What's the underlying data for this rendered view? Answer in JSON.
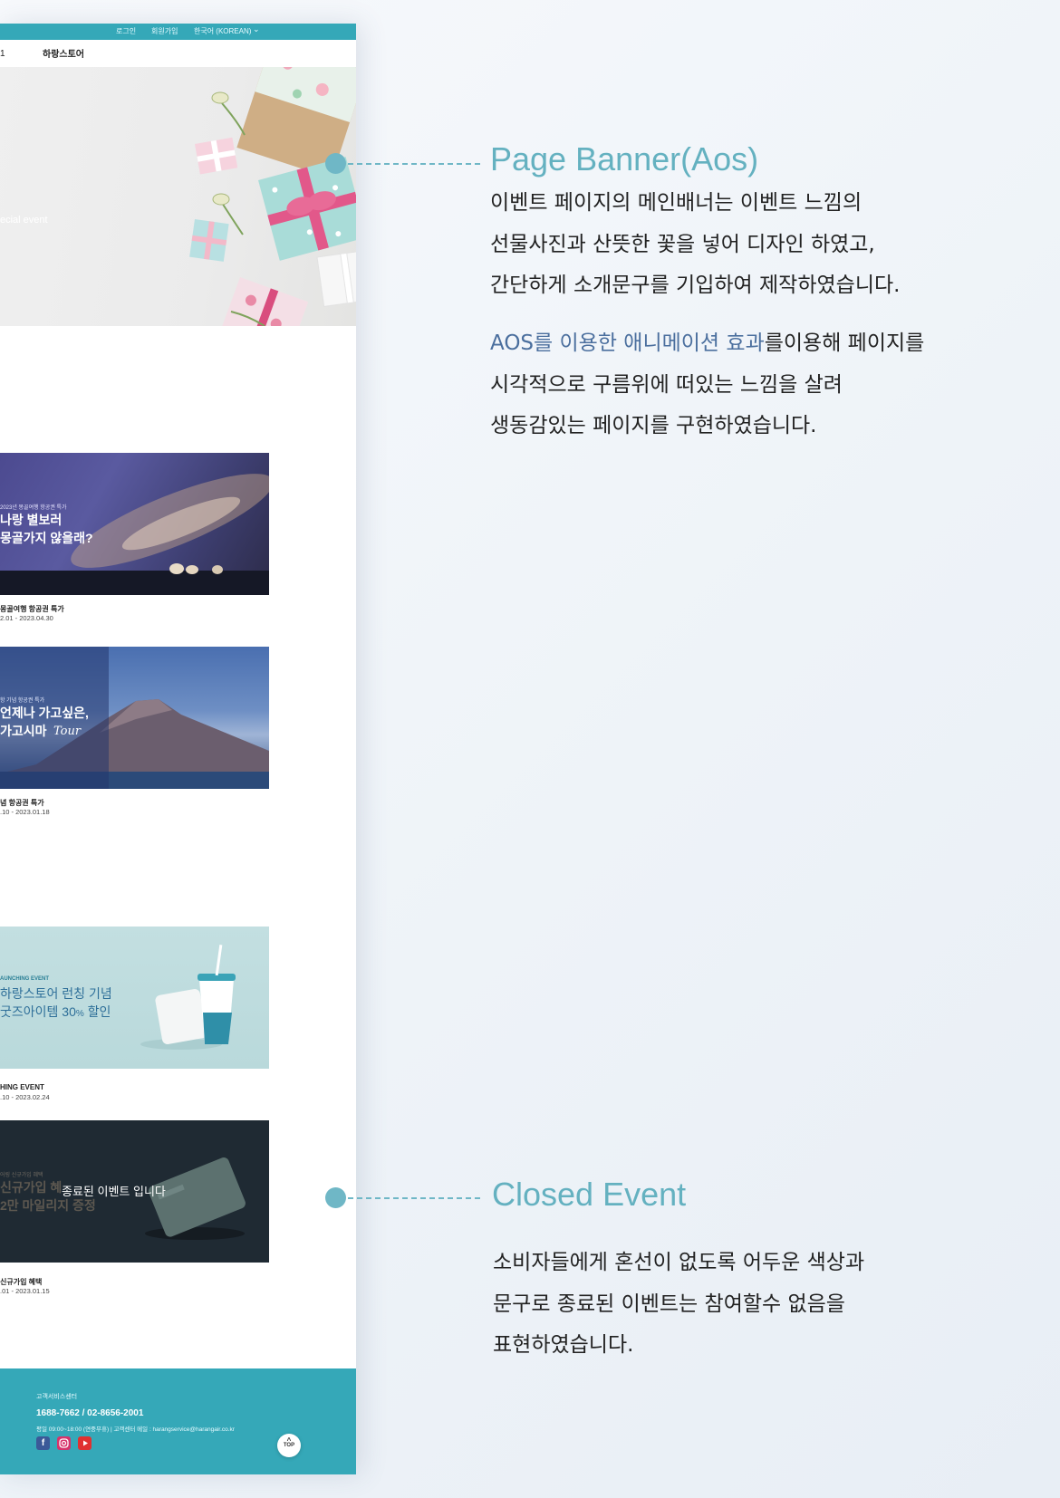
{
  "mockup": {
    "topbar": {
      "login": "로그인",
      "signup": "회원가입",
      "language": "한국어 (KOREAN)",
      "language_caret": "⌄"
    },
    "nav": {
      "left_glyph": "1",
      "brand": "하랑스토어"
    },
    "hero": {
      "caption": "ecial event"
    },
    "events": [
      {
        "banner_small": "2023년 몽골여행 항공권 특가",
        "banner_line1": "나랑 별보러",
        "banner_line2": "몽골가지 않을래?",
        "title": "몽골여행 항공권 특가",
        "date": "2.01 - 2023.04.30"
      },
      {
        "banner_small": "항 기념 항공권 특가",
        "banner_line1": "언제나 가고싶은,",
        "banner_line2": "가고시마",
        "banner_tour": "Tour",
        "title": "념 항공권 특가",
        "date": ".10 - 2023.01.18"
      },
      {
        "banner_small": "AUNCHING EVENT",
        "banner_line1": "하랑스토어 런칭 기념",
        "banner_line2_a": "굿즈아이템 30",
        "banner_line2_pct": "%",
        "banner_line2_b": " 할인",
        "title": "HING EVENT",
        "date": ".10 - 2023.02.24"
      },
      {
        "banner_small": "어링 신규가입 혜택",
        "banner_line1": "신규가입 혜",
        "banner_line2": "2만 마일리지 증정",
        "closed_label": "종료된 이벤트 입니다",
        "title": "신규가입 혜택",
        "date": ".01 - 2023.01.15"
      }
    ],
    "footer": {
      "center_label": "고객서비스센터",
      "phone": "1688-7662 / 02-8656-2001",
      "hours": "평일 09:00~18:00 (연중무휴)  |  고객센터 메일 : harangservice@harangair.co.kr",
      "top_label": "TOP",
      "top_arrow": "^"
    }
  },
  "annotations": [
    {
      "heading": "Page Banner(Aos)",
      "para1": "이벤트 페이지의 메인배너는 이벤트 느낌의 선물사진과 산뜻한 꽃을 넣어 디자인 하였고, 간단하게 소개문구를 기입하여 제작하였습니다.",
      "para2_highlight": "AOS를 이용한  애니메이션 효과",
      "para2_rest": "를이용해 페이지를 시각적으로 구름위에 떠있는 느낌을 살려 생동감있는 페이지를 구현하였습니다."
    },
    {
      "heading": "Closed Event",
      "para": "소비자들에게 혼선이 없도록 어두운 색상과 문구로 종료된 이벤트는 참여할수 없음을 표현하였습니다."
    }
  ],
  "colors": {
    "teal": "#35a8b8",
    "annotation_teal": "#64b1c0",
    "highlight_blue": "#4b6f9e",
    "closed_overlay": "#1f2a33"
  },
  "icons": [
    "facebook-icon",
    "instagram-icon",
    "youtube-icon",
    "chevron-down-icon",
    "arrow-up-icon"
  ]
}
